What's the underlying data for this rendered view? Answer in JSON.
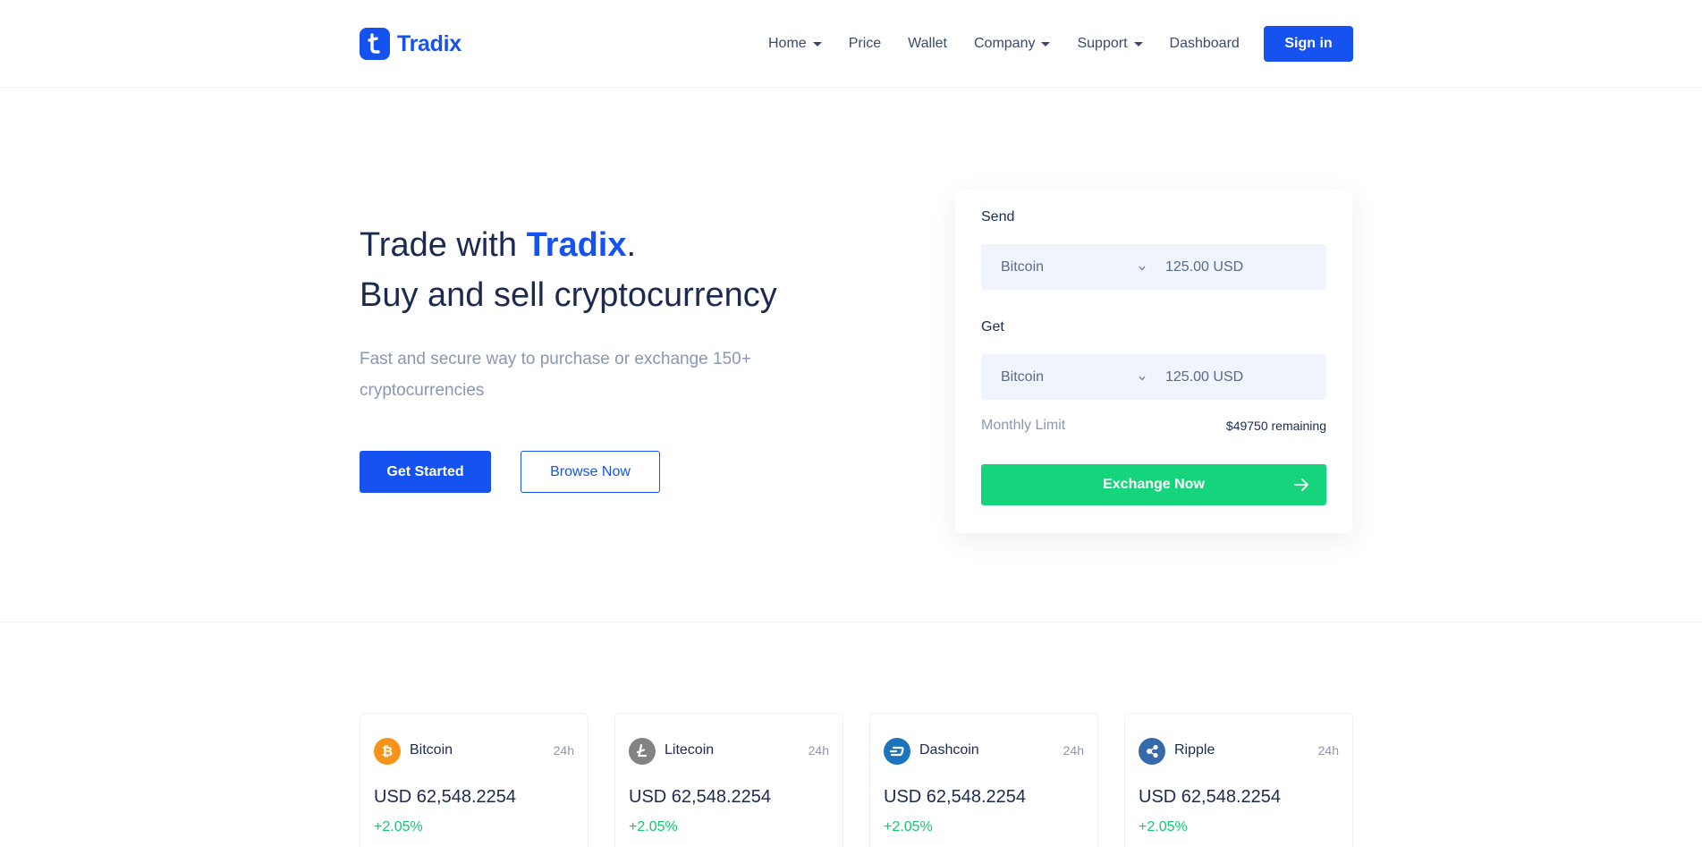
{
  "brand": {
    "name": "Tradix",
    "color": "#1652f0"
  },
  "nav": {
    "items": [
      {
        "label": "Home",
        "dropdown": true
      },
      {
        "label": "Price",
        "dropdown": false
      },
      {
        "label": "Wallet",
        "dropdown": false
      },
      {
        "label": "Company",
        "dropdown": true
      },
      {
        "label": "Support",
        "dropdown": true
      },
      {
        "label": "Dashboard",
        "dropdown": false
      }
    ],
    "signin_label": "Sign in"
  },
  "hero": {
    "title_prefix": "Trade with ",
    "title_accent": "Tradix",
    "title_suffix": ".",
    "title_line2": "Buy and sell cryptocurrency",
    "subtitle": "Fast and secure way to purchase or exchange 150+ cryptocurrencies",
    "primary_button": "Get Started",
    "secondary_button": "Browse Now"
  },
  "exchange": {
    "send_label": "Send",
    "send_currency": "Bitcoin",
    "send_amount": "125.00 USD",
    "get_label": "Get",
    "get_currency": "Bitcoin",
    "get_amount": "125.00 USD",
    "limit_label": "Monthly Limit",
    "limit_value": "$49750 remaining",
    "button_label": "Exchange Now",
    "button_color": "#16d47b"
  },
  "coins": [
    {
      "name": "Bitcoin",
      "period": "24h",
      "price": "USD 62,548.2254",
      "change": "+2.05%",
      "icon": "bitcoin-icon",
      "color": "#f7931a"
    },
    {
      "name": "Litecoin",
      "period": "24h",
      "price": "USD 62,548.2254",
      "change": "+2.05%",
      "icon": "litecoin-icon",
      "color": "#838383"
    },
    {
      "name": "Dashcoin",
      "period": "24h",
      "price": "USD 62,548.2254",
      "change": "+2.05%",
      "icon": "dashcoin-icon",
      "color": "#1c75bc"
    },
    {
      "name": "Ripple",
      "period": "24h",
      "price": "USD 62,548.2254",
      "change": "+2.05%",
      "icon": "ripple-icon",
      "color": "#346aa9"
    }
  ]
}
